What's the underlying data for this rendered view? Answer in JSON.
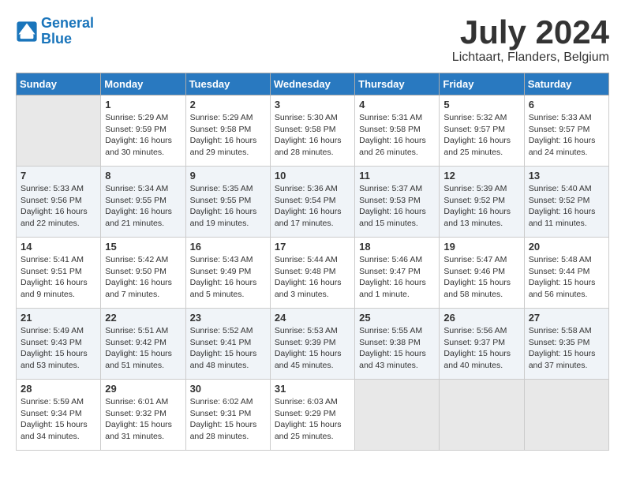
{
  "logo": {
    "line1": "General",
    "line2": "Blue"
  },
  "title": "July 2024",
  "location": "Lichtaart, Flanders, Belgium",
  "days_of_week": [
    "Sunday",
    "Monday",
    "Tuesday",
    "Wednesday",
    "Thursday",
    "Friday",
    "Saturday"
  ],
  "weeks": [
    [
      {
        "day": "",
        "content": ""
      },
      {
        "day": "1",
        "content": "Sunrise: 5:29 AM\nSunset: 9:59 PM\nDaylight: 16 hours\nand 30 minutes."
      },
      {
        "day": "2",
        "content": "Sunrise: 5:29 AM\nSunset: 9:58 PM\nDaylight: 16 hours\nand 29 minutes."
      },
      {
        "day": "3",
        "content": "Sunrise: 5:30 AM\nSunset: 9:58 PM\nDaylight: 16 hours\nand 28 minutes."
      },
      {
        "day": "4",
        "content": "Sunrise: 5:31 AM\nSunset: 9:58 PM\nDaylight: 16 hours\nand 26 minutes."
      },
      {
        "day": "5",
        "content": "Sunrise: 5:32 AM\nSunset: 9:57 PM\nDaylight: 16 hours\nand 25 minutes."
      },
      {
        "day": "6",
        "content": "Sunrise: 5:33 AM\nSunset: 9:57 PM\nDaylight: 16 hours\nand 24 minutes."
      }
    ],
    [
      {
        "day": "7",
        "content": "Sunrise: 5:33 AM\nSunset: 9:56 PM\nDaylight: 16 hours\nand 22 minutes."
      },
      {
        "day": "8",
        "content": "Sunrise: 5:34 AM\nSunset: 9:55 PM\nDaylight: 16 hours\nand 21 minutes."
      },
      {
        "day": "9",
        "content": "Sunrise: 5:35 AM\nSunset: 9:55 PM\nDaylight: 16 hours\nand 19 minutes."
      },
      {
        "day": "10",
        "content": "Sunrise: 5:36 AM\nSunset: 9:54 PM\nDaylight: 16 hours\nand 17 minutes."
      },
      {
        "day": "11",
        "content": "Sunrise: 5:37 AM\nSunset: 9:53 PM\nDaylight: 16 hours\nand 15 minutes."
      },
      {
        "day": "12",
        "content": "Sunrise: 5:39 AM\nSunset: 9:52 PM\nDaylight: 16 hours\nand 13 minutes."
      },
      {
        "day": "13",
        "content": "Sunrise: 5:40 AM\nSunset: 9:52 PM\nDaylight: 16 hours\nand 11 minutes."
      }
    ],
    [
      {
        "day": "14",
        "content": "Sunrise: 5:41 AM\nSunset: 9:51 PM\nDaylight: 16 hours\nand 9 minutes."
      },
      {
        "day": "15",
        "content": "Sunrise: 5:42 AM\nSunset: 9:50 PM\nDaylight: 16 hours\nand 7 minutes."
      },
      {
        "day": "16",
        "content": "Sunrise: 5:43 AM\nSunset: 9:49 PM\nDaylight: 16 hours\nand 5 minutes."
      },
      {
        "day": "17",
        "content": "Sunrise: 5:44 AM\nSunset: 9:48 PM\nDaylight: 16 hours\nand 3 minutes."
      },
      {
        "day": "18",
        "content": "Sunrise: 5:46 AM\nSunset: 9:47 PM\nDaylight: 16 hours\nand 1 minute."
      },
      {
        "day": "19",
        "content": "Sunrise: 5:47 AM\nSunset: 9:46 PM\nDaylight: 15 hours\nand 58 minutes."
      },
      {
        "day": "20",
        "content": "Sunrise: 5:48 AM\nSunset: 9:44 PM\nDaylight: 15 hours\nand 56 minutes."
      }
    ],
    [
      {
        "day": "21",
        "content": "Sunrise: 5:49 AM\nSunset: 9:43 PM\nDaylight: 15 hours\nand 53 minutes."
      },
      {
        "day": "22",
        "content": "Sunrise: 5:51 AM\nSunset: 9:42 PM\nDaylight: 15 hours\nand 51 minutes."
      },
      {
        "day": "23",
        "content": "Sunrise: 5:52 AM\nSunset: 9:41 PM\nDaylight: 15 hours\nand 48 minutes."
      },
      {
        "day": "24",
        "content": "Sunrise: 5:53 AM\nSunset: 9:39 PM\nDaylight: 15 hours\nand 45 minutes."
      },
      {
        "day": "25",
        "content": "Sunrise: 5:55 AM\nSunset: 9:38 PM\nDaylight: 15 hours\nand 43 minutes."
      },
      {
        "day": "26",
        "content": "Sunrise: 5:56 AM\nSunset: 9:37 PM\nDaylight: 15 hours\nand 40 minutes."
      },
      {
        "day": "27",
        "content": "Sunrise: 5:58 AM\nSunset: 9:35 PM\nDaylight: 15 hours\nand 37 minutes."
      }
    ],
    [
      {
        "day": "28",
        "content": "Sunrise: 5:59 AM\nSunset: 9:34 PM\nDaylight: 15 hours\nand 34 minutes."
      },
      {
        "day": "29",
        "content": "Sunrise: 6:01 AM\nSunset: 9:32 PM\nDaylight: 15 hours\nand 31 minutes."
      },
      {
        "day": "30",
        "content": "Sunrise: 6:02 AM\nSunset: 9:31 PM\nDaylight: 15 hours\nand 28 minutes."
      },
      {
        "day": "31",
        "content": "Sunrise: 6:03 AM\nSunset: 9:29 PM\nDaylight: 15 hours\nand 25 minutes."
      },
      {
        "day": "",
        "content": ""
      },
      {
        "day": "",
        "content": ""
      },
      {
        "day": "",
        "content": ""
      }
    ]
  ]
}
